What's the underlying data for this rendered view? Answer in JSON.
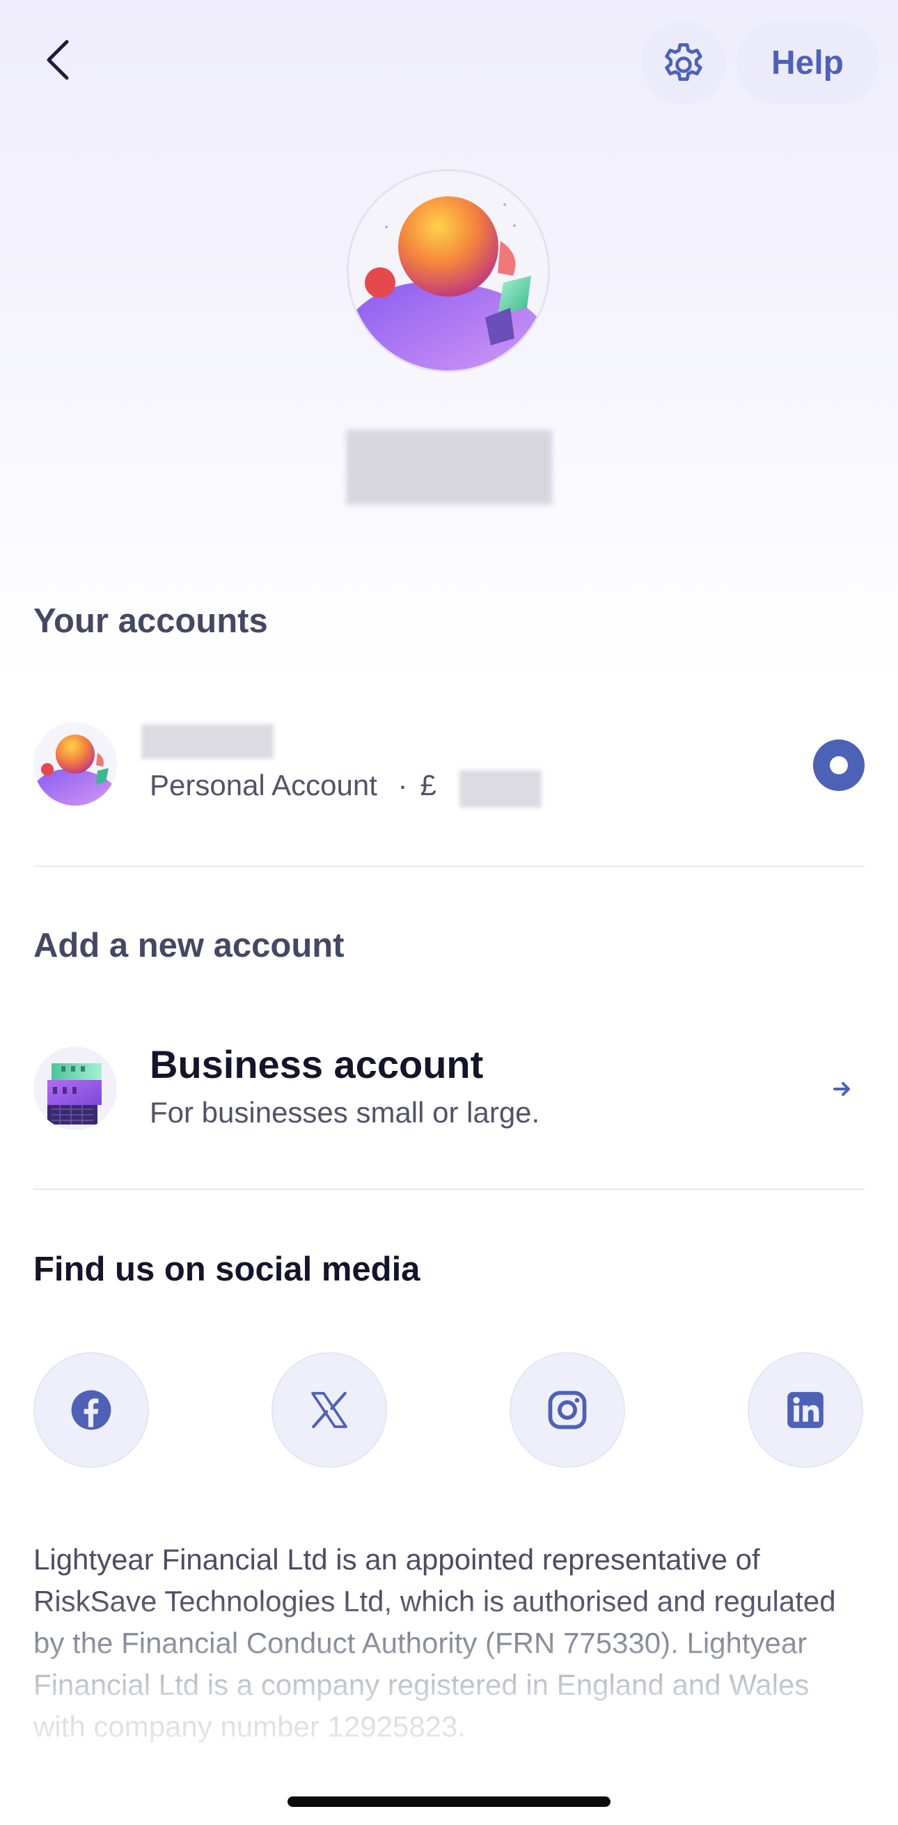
{
  "header": {
    "back_icon": "chevron-left-icon",
    "settings_icon": "gear-icon",
    "help_label": "Help"
  },
  "profile": {
    "avatar": "profile-avatar-illustration",
    "name_hidden": true
  },
  "accounts": {
    "heading": "Your accounts",
    "items": [
      {
        "type_label": "Personal Account",
        "separator": "·",
        "currency": "£",
        "selected": true
      }
    ]
  },
  "add_account": {
    "heading": "Add a new account",
    "options": [
      {
        "title": "Business account",
        "description": "For businesses small or large.",
        "icon": "business-building-illustration",
        "arrow_icon": "arrow-right-icon"
      }
    ]
  },
  "social": {
    "heading": "Find us on social media",
    "links": [
      {
        "name": "facebook",
        "icon": "facebook-icon"
      },
      {
        "name": "x",
        "icon": "x-icon"
      },
      {
        "name": "instagram",
        "icon": "instagram-icon"
      },
      {
        "name": "linkedin",
        "icon": "linkedin-icon"
      }
    ]
  },
  "disclaimer": "Lightyear Financial Ltd is an appointed representative of RiskSave Technologies Ltd, which is authorised and regulated by the Financial Conduct Authority (FRN 775330). Lightyear Financial Ltd is a company registered in England and Wales with company number 12925823.",
  "colors": {
    "accent": "#4d61b6",
    "heading_muted": "#454863",
    "text_dark": "#14152b",
    "icon_circle_bg": "#eeeffb"
  }
}
